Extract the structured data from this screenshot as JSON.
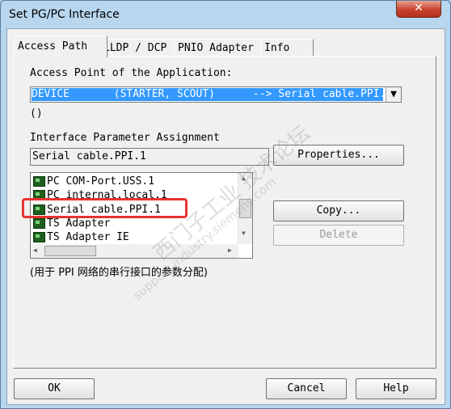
{
  "window": {
    "title": "Set PG/PC Interface",
    "close_glyph": "✕"
  },
  "tabs": [
    {
      "label": "Access Path"
    },
    {
      "label": "LLDP / DCP"
    },
    {
      "label": "PNIO Adapter"
    },
    {
      "label": "Info"
    }
  ],
  "access_point": {
    "label": "Access Point of the Application:",
    "selected": "DEVICE       (STARTER, SCOUT)      --> Serial cable.PPI.1",
    "description": "()"
  },
  "interface": {
    "label": "Interface Parameter Assignment",
    "value": "Serial cable.PPI.1",
    "items": [
      {
        "label": "PC COM-Port.USS.1",
        "icon": "network-card-icon"
      },
      {
        "label": "PC internal.local.1",
        "icon": "network-card-icon"
      },
      {
        "label": "Serial cable.PPI.1",
        "icon": "network-card-icon"
      },
      {
        "label": "TS Adapter",
        "icon": "network-card-icon"
      },
      {
        "label": "TS Adapter IE",
        "icon": "network-card-icon"
      }
    ],
    "description": "(用于 PPI 网络的串行接口的参数分配)"
  },
  "buttons": {
    "properties": "Properties...",
    "copy": "Copy...",
    "delete": "Delete",
    "ok": "OK",
    "cancel": "Cancel",
    "help": "Help"
  },
  "watermark": {
    "line1": "西门子工业 技术论坛",
    "line2": "support.industry.siemens.com"
  },
  "colors": {
    "selection": "#3399ff",
    "highlight_box": "#e8332e"
  }
}
